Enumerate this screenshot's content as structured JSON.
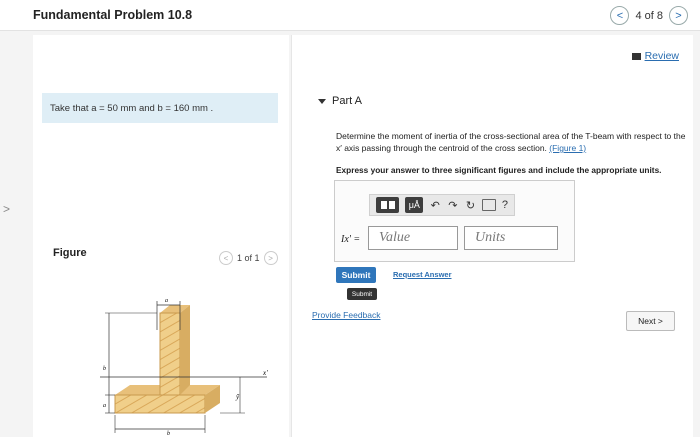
{
  "header": {
    "title": "Fundamental Problem 10.8",
    "counter": "4 of 8",
    "prev": "<",
    "next": ">"
  },
  "left": {
    "given": "Take that a = 50 mm and b = 160 mm .",
    "figure_label": "Figure",
    "pager": "1 of 1",
    "pager_prev": "<",
    "pager_next": ">",
    "side_chevron": ">"
  },
  "figure": {
    "label_a": "a",
    "label_b_left": "b",
    "label_a_left": "a",
    "label_b_bottom": "b",
    "label_x": "x'",
    "label_ybar": "ȳ"
  },
  "right": {
    "review": "Review",
    "part": "Part A",
    "question_pre": "Determine the moment of inertia of the cross-sectional area of the T-beam with respect to the x′ axis passing through the centroid of the cross section.",
    "question_link": "(Figure 1)",
    "instructions": "Express your answer to three significant figures and include the appropriate units.",
    "toolbar": {
      "mu": "μÅ",
      "help": "?"
    },
    "i_label": "Ix' =",
    "value_placeholder": "Value",
    "units_placeholder": "Units",
    "submit": "Submit",
    "request_answer": "Request Answer",
    "tooltip": "Submit",
    "provide_feedback": "Provide Feedback",
    "next_button": "Next >"
  }
}
